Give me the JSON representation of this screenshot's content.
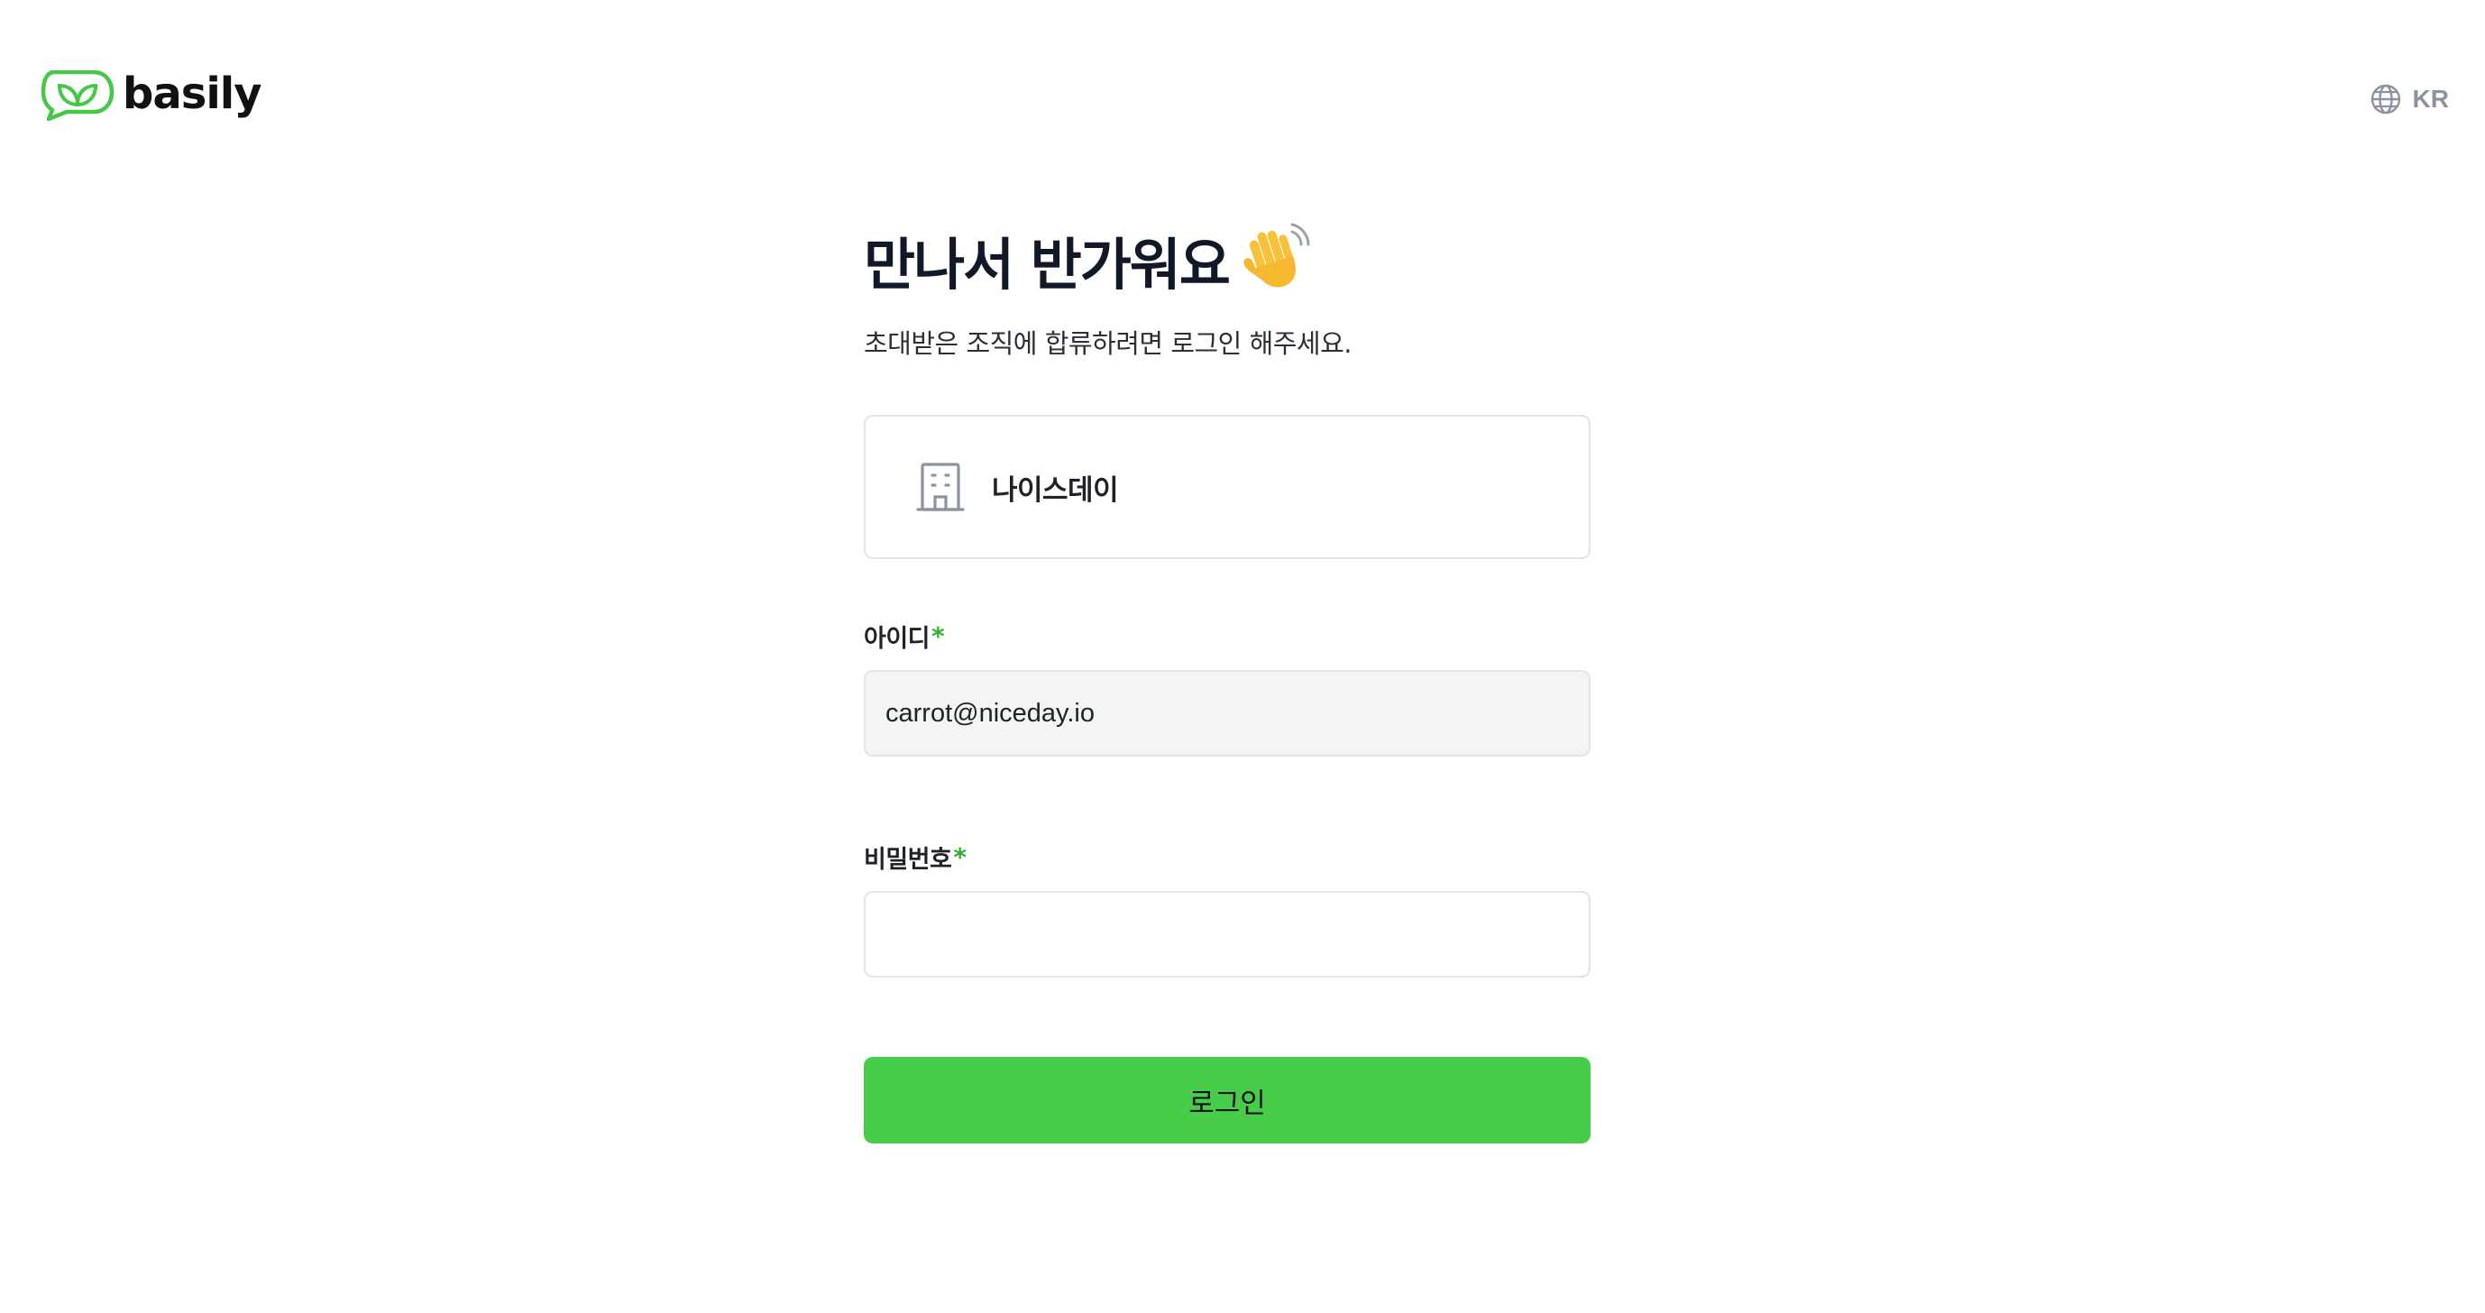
{
  "header": {
    "logo_text": "basily",
    "language_label": "KR"
  },
  "main": {
    "title": "만나서 반가워요",
    "title_emoji": "👋",
    "subtitle": "초대받은 조직에 합류하려면 로그인 해주세요.",
    "organization": {
      "name": "나이스데이",
      "icon": "building-icon"
    },
    "id_field": {
      "label": "아이디",
      "required_mark": "*",
      "value": "carrot@niceday.io"
    },
    "password_field": {
      "label": "비밀번호",
      "required_mark": "*",
      "value": ""
    },
    "login_button_label": "로그인"
  },
  "colors": {
    "brand_green": "#47cd49",
    "required_mark": "#2fb32f",
    "muted_gray": "#8b93a1"
  }
}
